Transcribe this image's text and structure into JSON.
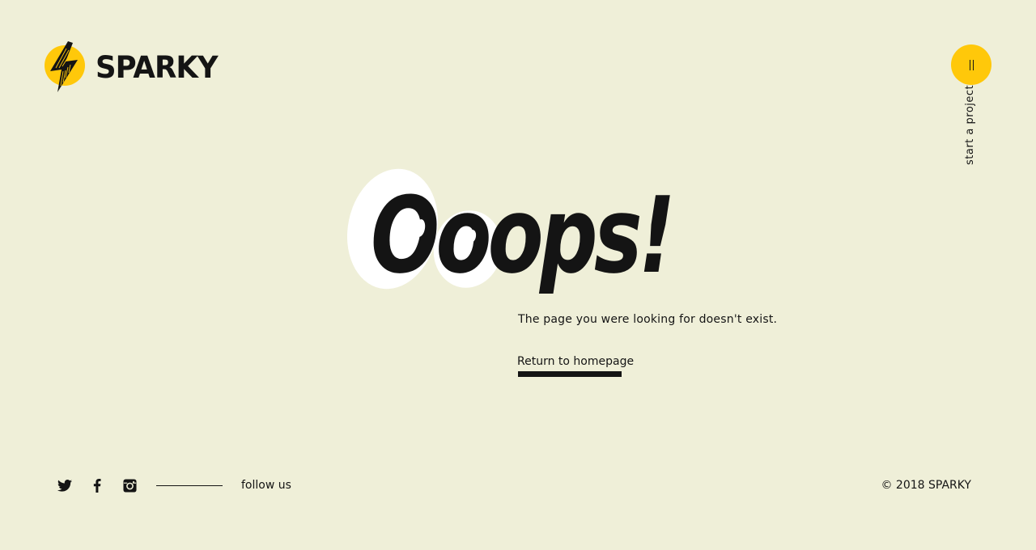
{
  "brand": {
    "name": "SPARKY",
    "accent_color": "#ffc80a",
    "background_color": "#efefd8",
    "text_color": "#141414",
    "logo_icon": "lightning-bolt-icon"
  },
  "cta": {
    "label": "start a project",
    "icon": "pause-bars-icon"
  },
  "error": {
    "headline": "Ooops!",
    "message": "The page you were looking for doesn't exist.",
    "home_link": "Return to homepage"
  },
  "footer": {
    "social": [
      {
        "name": "twitter",
        "icon": "twitter-icon"
      },
      {
        "name": "facebook",
        "icon": "facebook-icon"
      },
      {
        "name": "instagram",
        "icon": "instagram-icon"
      }
    ],
    "follow_label": "follow us",
    "copyright": "© 2018 SPARKY"
  }
}
